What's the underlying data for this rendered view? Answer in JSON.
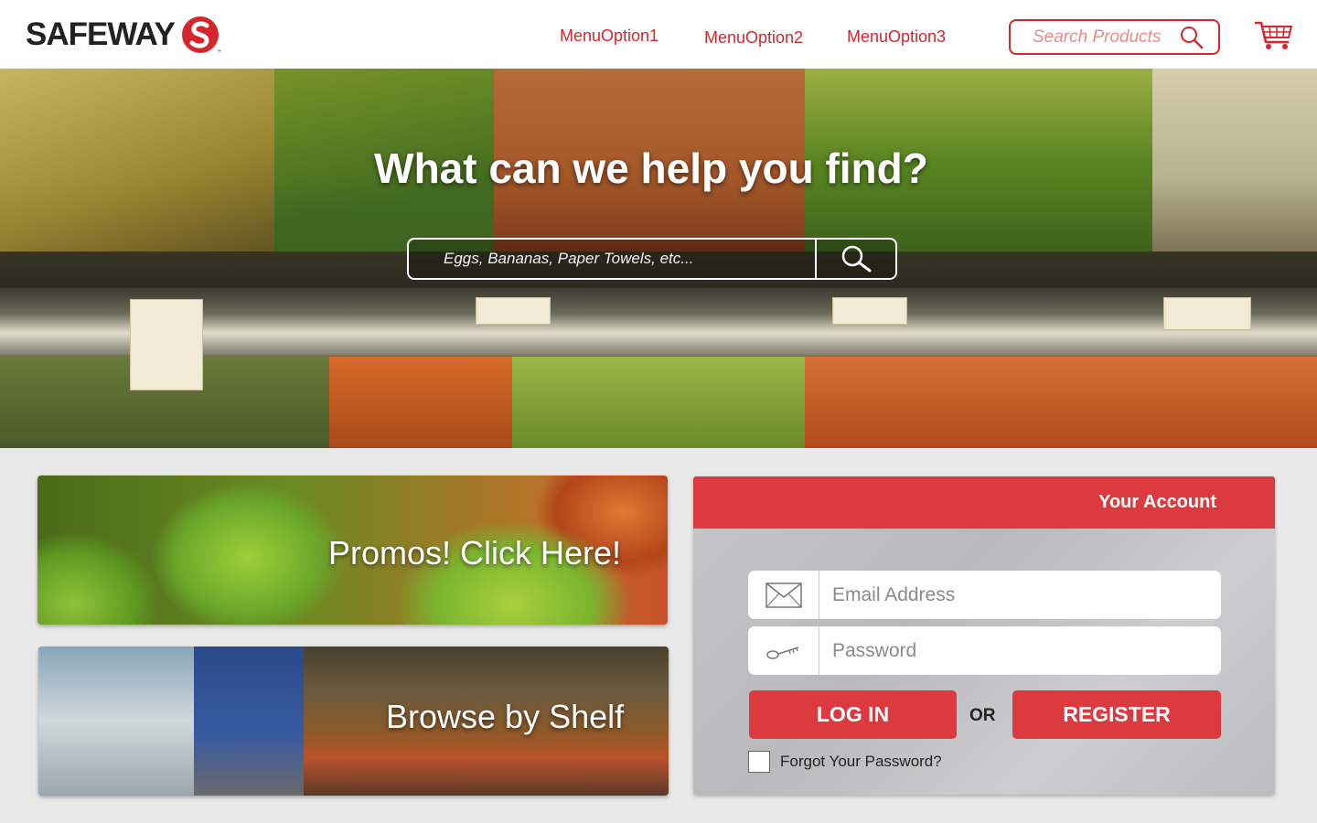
{
  "header": {
    "logo_text": "SAFEWAY",
    "menu": [
      "MenuOption1",
      "MenuOption2",
      "MenuOption3"
    ],
    "search_placeholder": "Search Products",
    "brand_color": "#d6262d"
  },
  "hero": {
    "title": "What can we help you find?",
    "search_placeholder": "Eggs, Bananas, Paper Towels, etc..."
  },
  "cards": {
    "promos_label": "Promos! Click Here!",
    "shelf_label": "Browse by Shelf"
  },
  "account": {
    "title": "Your Account",
    "email_placeholder": "Email Address",
    "password_placeholder": "Password",
    "login_label": "LOG IN",
    "or_label": "OR",
    "register_label": "REGISTER",
    "forgot_label": "Forgot Your Password?",
    "accent_color": "#dc3a3f"
  }
}
